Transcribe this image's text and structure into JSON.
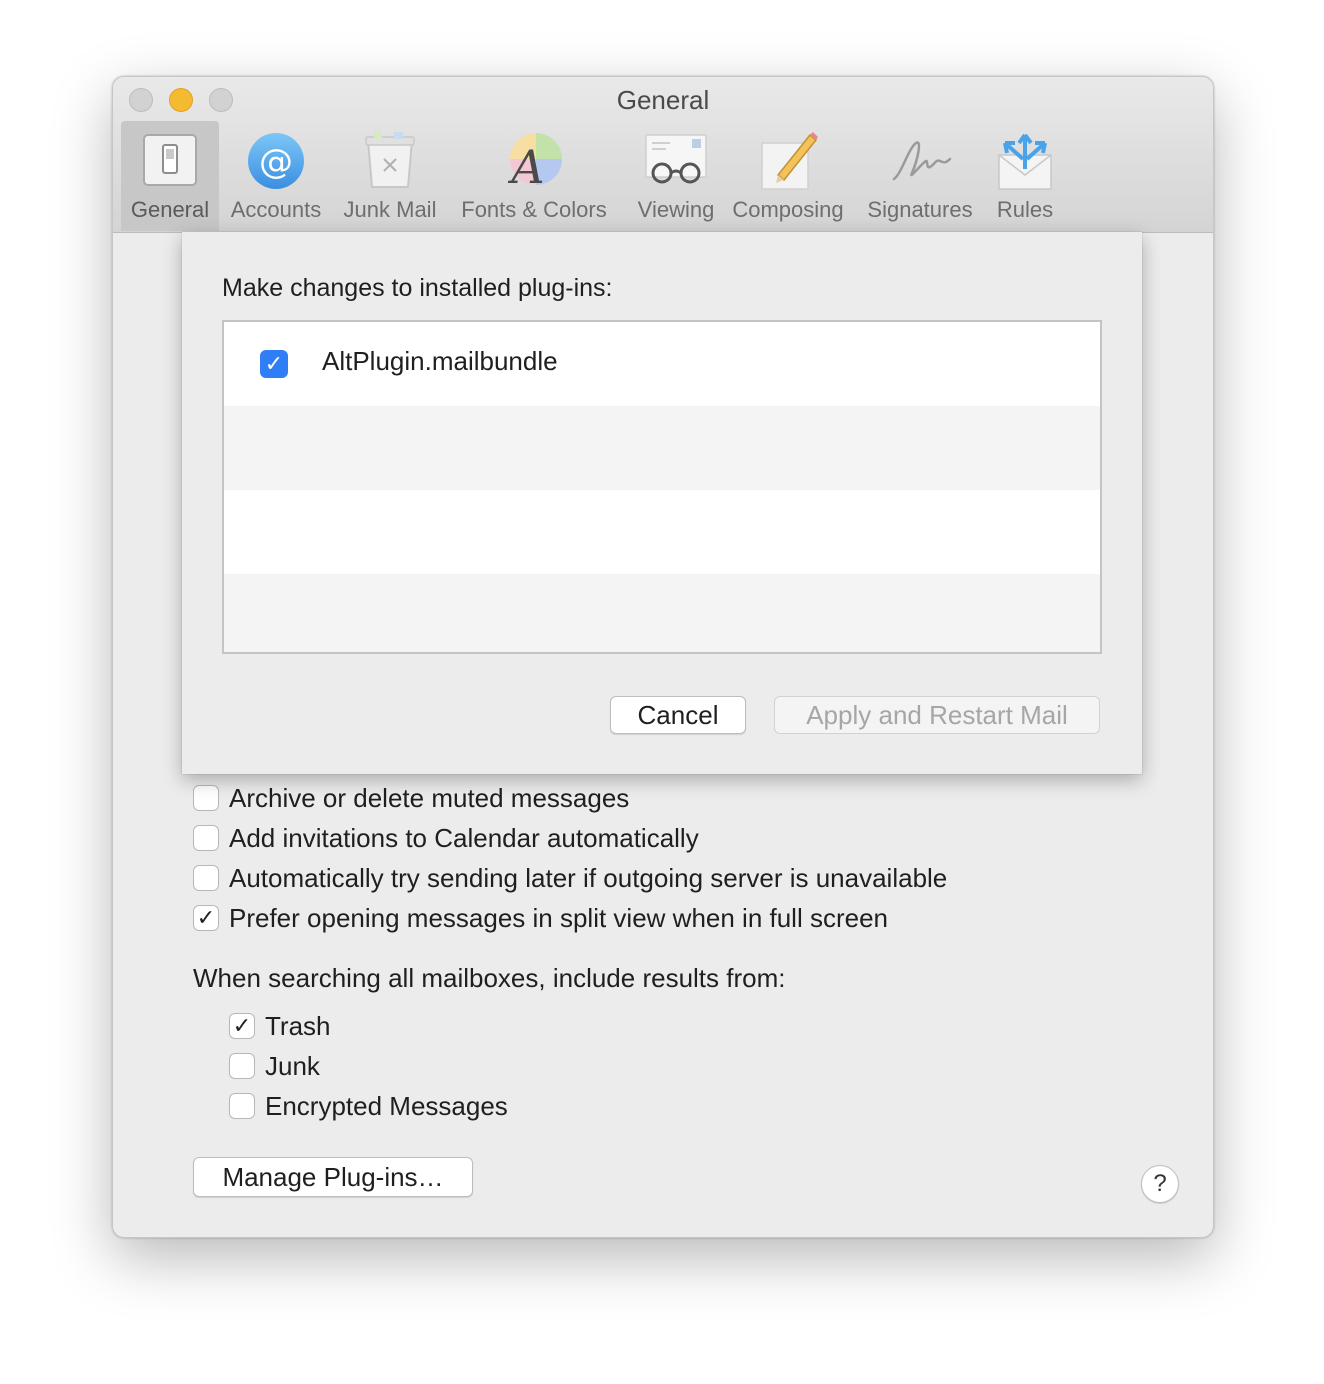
{
  "window": {
    "title": "General"
  },
  "toolbar": {
    "items": [
      {
        "label": "General",
        "icon": "general-switch-icon",
        "selected": true
      },
      {
        "label": "Accounts",
        "icon": "at-sign-icon"
      },
      {
        "label": "Junk Mail",
        "icon": "junk-bin-icon"
      },
      {
        "label": "Fonts & Colors",
        "icon": "font-color-icon"
      },
      {
        "label": "Viewing",
        "icon": "glasses-icon"
      },
      {
        "label": "Composing",
        "icon": "pencil-paper-icon"
      },
      {
        "label": "Signatures",
        "icon": "signature-icon"
      },
      {
        "label": "Rules",
        "icon": "rules-envelope-icon"
      }
    ]
  },
  "options": [
    {
      "label": "Archive or delete muted messages",
      "checked": false
    },
    {
      "label": "Add invitations to Calendar automatically",
      "checked": false
    },
    {
      "label": "Automatically try sending later if outgoing server is unavailable",
      "checked": false
    },
    {
      "label": "Prefer opening messages in split view when in full screen",
      "checked": true
    }
  ],
  "search": {
    "heading": "When searching all mailboxes, include results from:",
    "items": [
      {
        "label": "Trash",
        "checked": true
      },
      {
        "label": "Junk",
        "checked": false
      },
      {
        "label": "Encrypted Messages",
        "checked": false
      }
    ]
  },
  "manage_plugins_label": "Manage Plug-ins…",
  "help_label": "?",
  "sheet": {
    "prompt": "Make changes to installed plug-ins:",
    "plugins": [
      {
        "name": "AltPlugin.mailbundle",
        "enabled": true
      }
    ],
    "cancel_label": "Cancel",
    "apply_label": "Apply and Restart Mail"
  },
  "colors": {
    "accent": "#2f7ef5",
    "traffic_minimize": "#f5bb30",
    "disabled_text": "#a6a6a6"
  },
  "glyphs": {
    "check": "✓"
  }
}
